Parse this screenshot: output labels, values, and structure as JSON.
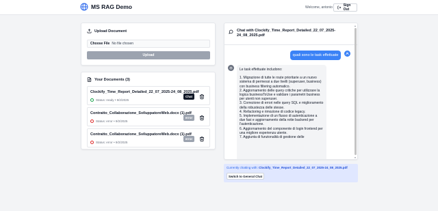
{
  "app": {
    "name": "MS RAG Demo"
  },
  "header": {
    "welcome_text": "Welcome, antonio",
    "signout_label": "Sign Out"
  },
  "upload": {
    "title": "Upload Document",
    "choose_file_label": "Choose File",
    "file_status": "No file chosen",
    "upload_button": "Upload"
  },
  "documents": {
    "title": "Your Documents (3)",
    "items": [
      {
        "name": "Clockify_Time_Report_Detailed_22_07_2025-24_08_2025.pdf",
        "status": "Status: ready • 9/2/2025",
        "action": "Chat",
        "state": "ready"
      },
      {
        "name": "Contratto_Collaborazione_SviluppatoreWeb.docx (1).pdf",
        "status": "Status: error • 9/2/2025",
        "action": "error",
        "state": "error"
      },
      {
        "name": "Contratto_Collaborazione_SviluppatoreWeb.docx (1).pdf",
        "status": "Status: error • 9/2/2025",
        "action": "error",
        "state": "error"
      }
    ]
  },
  "chat": {
    "title": "Chat with Clockify_Time_Report_Detailed_22_07_2025-24_08_2025.pdf",
    "user_message": "quali sono le task effettuate",
    "bot_intro": "Le task effettuate includono:",
    "bot_items": [
      "1. Migrazione di tutte le route prioritarie a un nuovo sistema di permessi a due livelli (superuser, business) con business filtering automatico.",
      "2. Aggiornamento delle query critiche per utilizzare la logica businessToUse e validare i parametri business per utenti non superuser.",
      "3. Correzione di errori nelle query SQL e miglioramento della robustezza delle stesse.",
      "4. Refactoring e rimozione di codice legacy.",
      "5. Implementazione di un flusso di autenticazione a due fasi e aggiornamento della rotte backend per l'autenticazione.",
      "6. Aggiornamento del componente di login frontend per una migliore esperienza utente.",
      "7. Aggiunta di funzionalità di gestione delle"
    ]
  },
  "chat_context": {
    "label": "Currently chatting with:",
    "document": "Clockify_Time_Report_Detailed_22_07_2025-24_08_2025.pdf",
    "switch_button": "Switch to General Chat"
  },
  "colors": {
    "accent": "#3b82f6",
    "primary_dark": "#111827",
    "disabled": "#9ca3af",
    "context_bg": "#e0e7ff"
  }
}
